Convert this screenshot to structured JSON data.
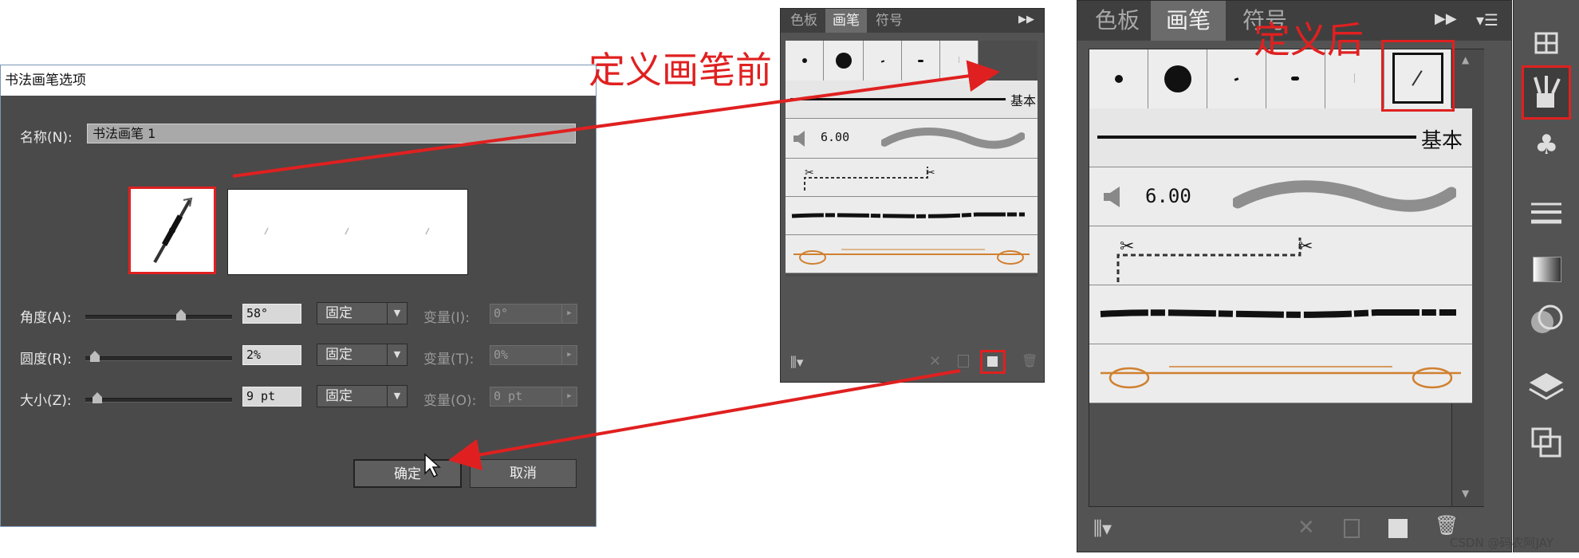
{
  "annotations": {
    "before": "定义画笔前",
    "after": "定义后"
  },
  "dialog": {
    "title": "书法画笔选项",
    "name_label": "名称(N):",
    "name_value": "书法画笔 1",
    "rows": [
      {
        "label": "角度(A):",
        "value": "58°",
        "mode": "固定",
        "variation_label": "变量(I):",
        "variation_value": "0°",
        "slider_level": 0.65
      },
      {
        "label": "圆度(R):",
        "value": "2%",
        "mode": "固定",
        "variation_label": "变量(T):",
        "variation_value": "0%",
        "slider_level": 0.02
      },
      {
        "label": "大小(Z):",
        "value": "9 pt",
        "mode": "固定",
        "variation_label": "变量(O):",
        "variation_value": "0 pt",
        "slider_level": 0.05
      }
    ],
    "ok_label": "确定",
    "cancel_label": "取消"
  },
  "brush_panel": {
    "tabs": [
      "色板",
      "画笔",
      "符号"
    ],
    "active_tab": "画笔",
    "basic_label": "基本",
    "stroke_weight": "6.00",
    "new_brush_highlight_color": "#e02020"
  },
  "icons": {
    "brush-library": "brush-library-icon",
    "remove-stroke": "remove-brush-stroke-icon",
    "options": "brush-options-icon",
    "new-brush": "new-brush-icon",
    "delete": "trash-icon",
    "panel-menu": "panel-menu-icon",
    "collapse": "double-chevron-icon"
  },
  "watermark": "CSDN @码农阿JAY"
}
